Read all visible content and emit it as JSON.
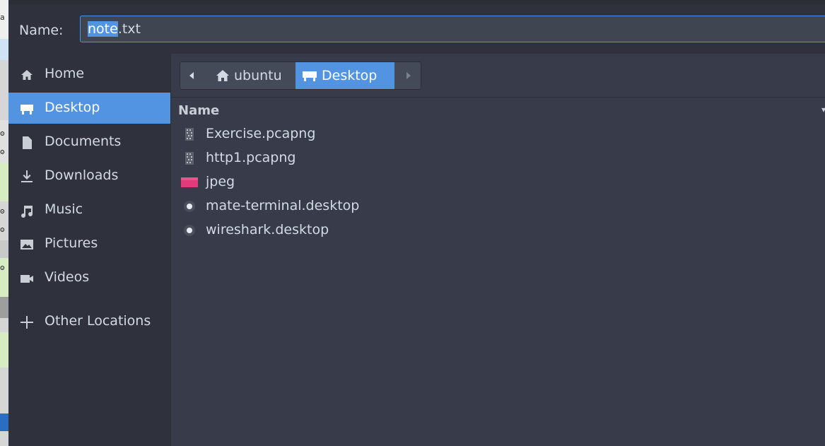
{
  "dialog": {
    "name_label": "Name:",
    "filename_selected": "note",
    "filename_rest": ".txt"
  },
  "sidebar": {
    "items": [
      {
        "label": "Home",
        "icon": "home-icon",
        "active": false
      },
      {
        "label": "Desktop",
        "icon": "desktop-icon",
        "active": true
      },
      {
        "label": "Documents",
        "icon": "document-icon",
        "active": false
      },
      {
        "label": "Downloads",
        "icon": "download-icon",
        "active": false
      },
      {
        "label": "Music",
        "icon": "music-icon",
        "active": false
      },
      {
        "label": "Pictures",
        "icon": "pictures-icon",
        "active": false
      },
      {
        "label": "Videos",
        "icon": "video-icon",
        "active": false
      },
      {
        "label": "Other Locations",
        "icon": "plus-icon",
        "active": false
      }
    ]
  },
  "pathbar": {
    "segments": [
      "ubuntu",
      "Desktop"
    ]
  },
  "filelist": {
    "column_name": "Name",
    "files": [
      {
        "name": "Exercise.pcapng",
        "icon": "pcap-file-icon"
      },
      {
        "name": "http1.pcapng",
        "icon": "pcap-file-icon"
      },
      {
        "name": "jpeg",
        "icon": "image-file-icon"
      },
      {
        "name": "mate-terminal.desktop",
        "icon": "desktop-launcher-icon"
      },
      {
        "name": "wireshark.desktop",
        "icon": "desktop-launcher-icon"
      }
    ]
  },
  "colors": {
    "accent": "#5294e2",
    "sidebar_bg": "#2f323c",
    "main_bg": "#383c4a"
  }
}
